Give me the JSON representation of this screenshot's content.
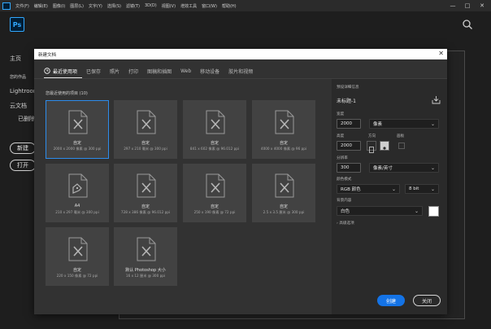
{
  "menubar": {
    "items": [
      "文件(F)",
      "编辑(E)",
      "图像(I)",
      "图层(L)",
      "文字(Y)",
      "选择(S)",
      "滤镜(T)",
      "3D(D)",
      "视图(V)",
      "增效工具",
      "窗口(W)",
      "帮助(H)"
    ],
    "min": "—",
    "max": "□",
    "close": "✕"
  },
  "home": {
    "logo": "Ps",
    "nav": [
      "主页",
      "您的作品",
      "Lightroom",
      "云文档",
      "已删除"
    ],
    "new_label": "新建",
    "open_label": "打开"
  },
  "dialog": {
    "title": "新建文档",
    "close": "✕",
    "tabs": [
      "最近使用项",
      "已保存",
      "照片",
      "打印",
      "图稿和插图",
      "Web",
      "移动设备",
      "胶片和视频"
    ],
    "recent_title": "您最近使用的项目 (10)",
    "cards": [
      {
        "name": "自定",
        "desc": "2000 x 2000 像素 @ 300 ppi"
      },
      {
        "name": "自定",
        "desc": "297 x 210 毫米 @ 300 ppi"
      },
      {
        "name": "自定",
        "desc": "841 x 602 像素 @ 96.012 ppi"
      },
      {
        "name": "自定",
        "desc": "4000 x 4000 像素 @ 96 ppi"
      },
      {
        "name": "A4",
        "desc": "210 x 297 毫米 @ 300 ppi"
      },
      {
        "name": "自定",
        "desc": "728 x 386 像素 @ 96.012 ppi"
      },
      {
        "name": "自定",
        "desc": "250 x 190 像素 @ 72 ppi"
      },
      {
        "name": "自定",
        "desc": "2.5 x 3.5 厘米 @ 300 ppi"
      },
      {
        "name": "自定",
        "desc": "220 x 150 像素 @ 72 ppi"
      },
      {
        "name": "默认 Photoshop 大小",
        "desc": "16 x 12 厘米 @ 300 ppi"
      }
    ],
    "details": {
      "section_title": "预设详细信息",
      "doc_name": "未标题-1",
      "width_label": "宽度",
      "width_value": "2000",
      "width_unit": "像素",
      "height_label": "高度",
      "height_value": "2000",
      "orientation_label": "方向",
      "artboard_label": "画板",
      "resolution_label": "分辨率",
      "resolution_value": "300",
      "resolution_unit": "像素/英寸",
      "color_mode_label": "颜色模式",
      "color_mode_value": "RGB 颜色",
      "bit_depth": "8 bit",
      "background_label": "背景内容",
      "background_value": "白色",
      "advanced_label": "高级选项"
    },
    "create_label": "创建",
    "close_label": "关闭"
  },
  "colors": {
    "accent": "#1473e6",
    "selected_border": "#2d8ceb",
    "ps_blue": "#31a8ff"
  }
}
